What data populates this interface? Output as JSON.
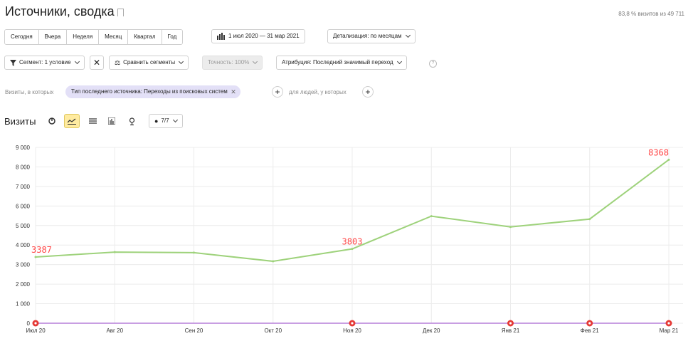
{
  "header": {
    "title": "Источники, сводка",
    "summary": "83,8 % визитов из 49 711"
  },
  "toolbar": {
    "periods": [
      "Сегодня",
      "Вчера",
      "Неделя",
      "Месяц",
      "Квартал",
      "Год"
    ],
    "date_range": "1 июл 2020 — 31 мар 2021",
    "detail": "Детализация: по месяцам",
    "segment": "Сегмент: 1 условие",
    "compare": "Сравнить сегменты",
    "accuracy": "Точность: 100%",
    "attribution": "Атрибуция: Последний значимый переход"
  },
  "filters": {
    "visits_label": "Визиты, в которых",
    "chip": "Тип последнего источника: Переходы из поисковых систем",
    "people_label": "для людей, у которых"
  },
  "chart_panel": {
    "title": "Визиты",
    "series_count": "7/7"
  },
  "chart_data": {
    "type": "line",
    "categories": [
      "Июл 20",
      "Авг 20",
      "Сен 20",
      "Окт 20",
      "Ноя 20",
      "Дек 20",
      "Янв 21",
      "Фев 21",
      "Мар 21"
    ],
    "series": [
      {
        "values": [
          3387,
          3640,
          3610,
          3170,
          3803,
          5480,
          4930,
          5330,
          8368
        ],
        "color": "#9ed27b"
      }
    ],
    "secondary_line": {
      "values": [
        0,
        0,
        0,
        0,
        0,
        0,
        0,
        0,
        0
      ],
      "color": "#b57ed8"
    },
    "data_labels": [
      {
        "index": 0,
        "text": "3387"
      },
      {
        "index": 4,
        "text": "3803"
      },
      {
        "index": 8,
        "text": "8368"
      }
    ],
    "annotation_markers": [
      0,
      4,
      6,
      7,
      8
    ],
    "y_ticks": [
      "0",
      "1 000",
      "2 000",
      "3 000",
      "4 000",
      "5 000",
      "6 000",
      "7 000",
      "8 000",
      "9 000"
    ],
    "ylim": [
      0,
      9000
    ],
    "grid": true,
    "label_color": "#ff4646"
  }
}
